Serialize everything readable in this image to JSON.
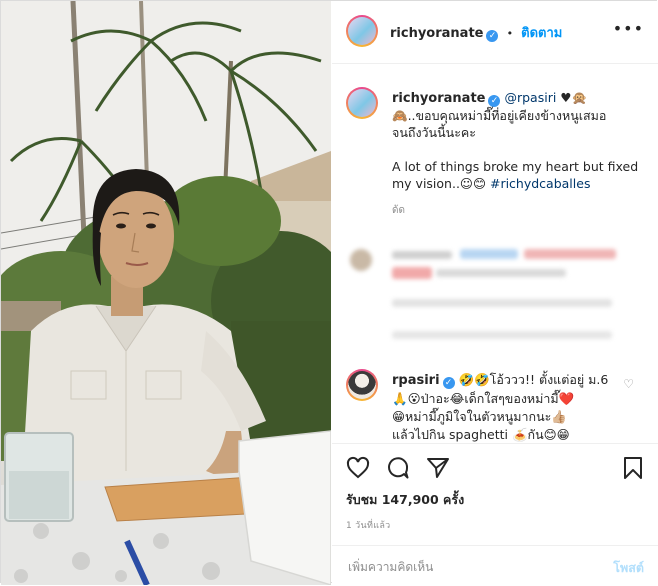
{
  "post": {
    "author": "richyoranate",
    "follow_sep": "•",
    "follow_label": "ติดตาม",
    "more_icon": "more-options-icon",
    "caption": {
      "author": "richyoranate",
      "mention": "@rpasiri",
      "line1_tail": "🙈..ขอบคุณหม่ามี๊ที่อยู่เคียงข้างหนูเสมอ",
      "line1_emoji": "♥🙊",
      "line2": "จนถึงวันนี้นะคะ",
      "english": "A lot of things broke my heart but fixed my vision..☺😊",
      "hashtag": "#richydcaballes",
      "small_time": "ด้ด"
    },
    "comment": {
      "author": "rpasiri",
      "line1": "🤣🤣โอ้ววว!! ตั้งแต่อยู่ ม.6",
      "line2": "🙏😮ป่าอะ😂เด็กใสๆของหม่ามี๊❤️",
      "line3": "😁หม่ามี๊ภูมิใจในตัวหนูมากนะ👍🏼",
      "line4": "แล้วไปกิน spaghetti 🍝กัน😊😁"
    },
    "likes_label": "รับชม 147,900 ครั้ง",
    "date_label": "1 วันที่แล้ว",
    "comment_placeholder": "เพิ่มความคิดเห็น",
    "post_button": "โพสต์"
  },
  "colors": {
    "link": "#0095f6",
    "verified": "#3897f0",
    "muted": "#8e8e8e",
    "border": "#dbdbdb"
  },
  "icons": [
    "heart-icon",
    "comment-icon",
    "share-icon",
    "bookmark-icon",
    "verified-icon",
    "small-heart-icon"
  ]
}
